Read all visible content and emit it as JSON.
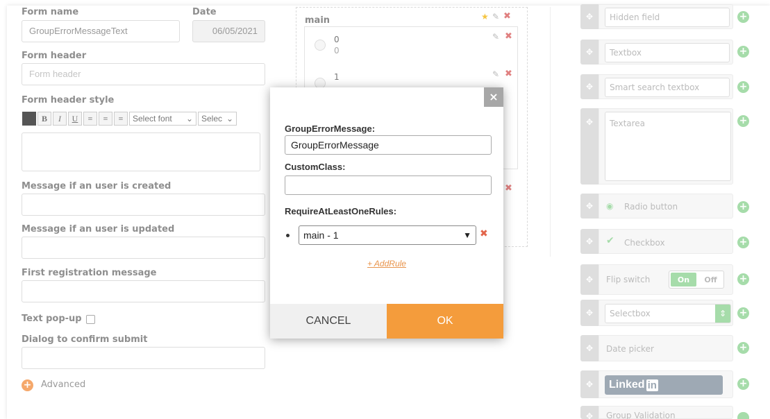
{
  "form": {
    "form_name_label": "Form name",
    "form_name_value": "GroupErrorMessageText",
    "date_label": "Date",
    "date_value": "06/05/2021",
    "form_header_label": "Form header",
    "form_header_placeholder": "Form header",
    "form_header_style_label": "Form header style",
    "toolbar": {
      "bold": "B",
      "italic": "I",
      "underline": "U",
      "align_left": "≡",
      "align_center": "≡",
      "align_right": "≡",
      "font_select": "Select font",
      "size_select": "Selec"
    },
    "msg_created_label": "Message if an user is created",
    "msg_updated_label": "Message if an user is updated",
    "first_registration_label": "First registration message",
    "text_popup_label": "Text pop-up",
    "dialog_confirm_label": "Dialog to confirm submit",
    "advanced_label": "Advanced"
  },
  "middle": {
    "title": "main",
    "options": [
      {
        "value": "0",
        "sub": "0"
      },
      {
        "value": "1",
        "sub": ""
      }
    ]
  },
  "palette": {
    "hidden_field": "Hidden field",
    "textbox": "Textbox",
    "smart_search": "Smart search textbox",
    "textarea": "Textarea",
    "radio_button": "Radio button",
    "checkbox": "Checkbox",
    "flip_switch": "Flip switch",
    "flip_on": "On",
    "flip_off": "Off",
    "selectbox": "Selectbox",
    "date_picker": "Date picker",
    "linkedin": "Linked",
    "linkedin_in": "in",
    "group_validation": "Group Validation"
  },
  "modal": {
    "group_error_label": "GroupErrorMessage:",
    "group_error_value": "GroupErrorMessage",
    "custom_class_label": "CustomClass:",
    "custom_class_value": "",
    "require_rules_label": "RequireAtLeastOneRules:",
    "rule_selected": "main - 1",
    "add_rule": "+ AddRule",
    "cancel": "CANCEL",
    "ok": "OK",
    "close": "×"
  },
  "colors": {
    "accent_orange": "#f49c3c",
    "palette_green": "#a6dcaa",
    "remove_red": "#e2654b"
  }
}
